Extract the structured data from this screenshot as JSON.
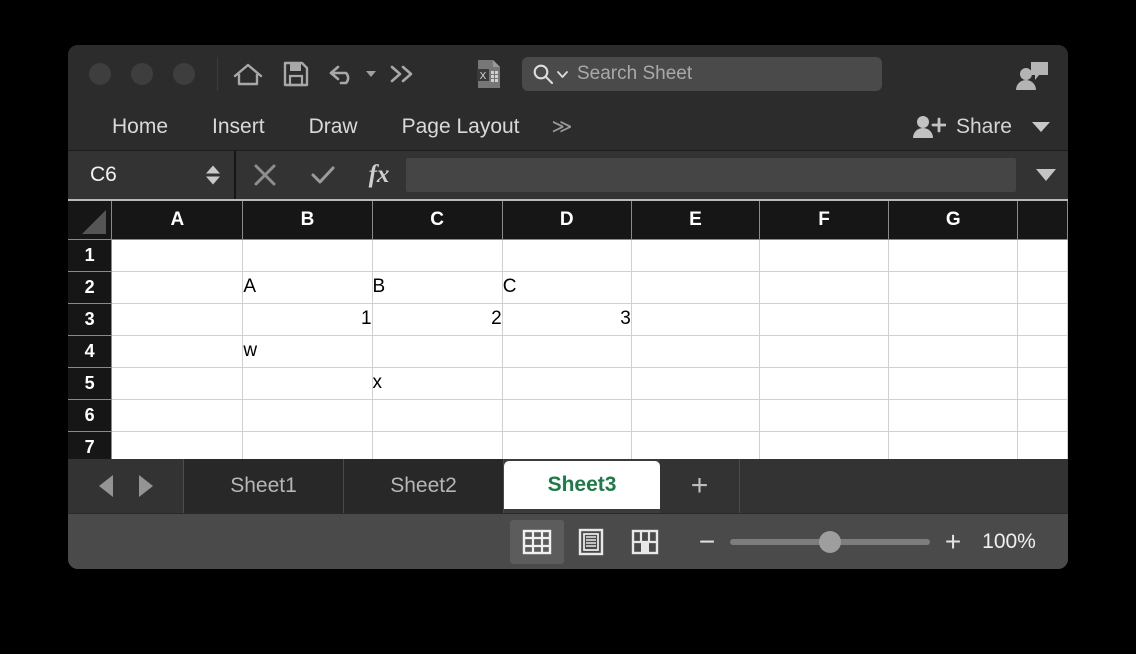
{
  "window": {
    "titlebar": {
      "traffic_lights": [
        "close",
        "minimize",
        "maximize"
      ],
      "quick_access": [
        {
          "name": "home-icon",
          "label": "Home"
        },
        {
          "name": "save-icon",
          "label": "Save"
        },
        {
          "name": "undo-icon",
          "label": "Undo"
        },
        {
          "name": "more-icon",
          "label": "More"
        }
      ],
      "file_icon": "excel-file-icon",
      "search": {
        "placeholder": "Search Sheet",
        "value": "",
        "icon": "search-icon"
      },
      "comments_icon": "comments-icon"
    },
    "ribbon": {
      "tabs": [
        "Home",
        "Insert",
        "Draw",
        "Page Layout"
      ],
      "overflow": "≫",
      "share_label": "Share",
      "share_icon": "add-person-icon",
      "share_caret": "chevron-down-icon"
    },
    "formula_bar": {
      "name_box": "C6",
      "cancel_icon": "cancel-icon",
      "confirm_icon": "confirm-icon",
      "function_icon": "fx",
      "formula_value": "",
      "expand_icon": "chevron-down-icon"
    }
  },
  "grid": {
    "columns": [
      "A",
      "B",
      "C",
      "D",
      "E",
      "F",
      "G"
    ],
    "rows": [
      "1",
      "2",
      "3",
      "4",
      "5",
      "6",
      "7"
    ],
    "cells": [
      [
        "",
        "",
        "",
        "",
        "",
        "",
        ""
      ],
      [
        "",
        "A",
        "B",
        "C",
        "",
        "",
        ""
      ],
      [
        "",
        "1",
        "2",
        "3",
        "",
        "",
        ""
      ],
      [
        "",
        "w",
        "",
        "",
        "",
        "",
        ""
      ],
      [
        "",
        "",
        "x",
        "",
        "",
        "",
        ""
      ],
      [
        "",
        "",
        "",
        "",
        "",
        "",
        ""
      ],
      [
        "",
        "",
        "",
        "",
        "",
        "",
        ""
      ]
    ],
    "alignments": [
      [
        "txt",
        "txt",
        "txt",
        "txt",
        "txt",
        "txt",
        "txt"
      ],
      [
        "txt",
        "txt",
        "txt",
        "txt",
        "txt",
        "txt",
        "txt"
      ],
      [
        "txt",
        "num",
        "num",
        "num",
        "txt",
        "txt",
        "txt"
      ],
      [
        "txt",
        "txt",
        "txt",
        "txt",
        "txt",
        "txt",
        "txt"
      ],
      [
        "txt",
        "txt",
        "txt",
        "txt",
        "txt",
        "txt",
        "txt"
      ],
      [
        "txt",
        "txt",
        "txt",
        "txt",
        "txt",
        "txt",
        "txt"
      ],
      [
        "txt",
        "txt",
        "txt",
        "txt",
        "txt",
        "txt",
        "txt"
      ]
    ],
    "selected_cell": "C6",
    "active_sheet_text_color": "#1e7a46"
  },
  "sheet_tabs": {
    "prev_icon": "chevron-left-icon",
    "next_icon": "chevron-right-icon",
    "tabs": [
      {
        "label": "Sheet1",
        "active": false
      },
      {
        "label": "Sheet2",
        "active": false
      },
      {
        "label": "Sheet3",
        "active": true
      }
    ],
    "add_label": "+"
  },
  "status_bar": {
    "views": [
      {
        "name": "normal-view-icon",
        "selected": true
      },
      {
        "name": "page-layout-view-icon",
        "selected": false
      },
      {
        "name": "page-break-view-icon",
        "selected": false
      }
    ],
    "zoom_out": "−",
    "zoom_in": "+",
    "zoom_percent": "100%",
    "zoom_value": 100
  }
}
